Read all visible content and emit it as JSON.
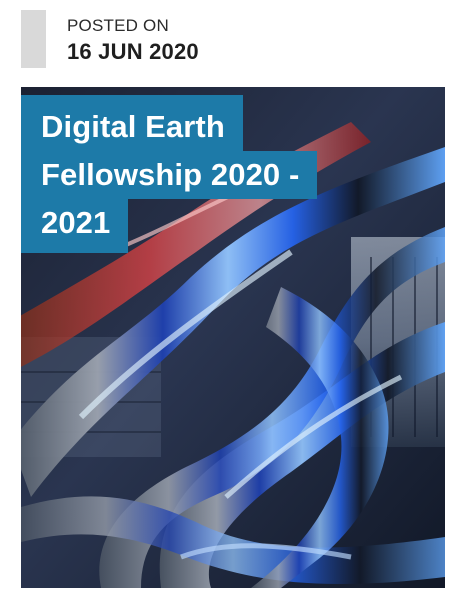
{
  "post_meta": {
    "posted_label": "POSTED ON",
    "date": "16 JUN 2020"
  },
  "featured": {
    "title_lines": [
      "Digital Earth",
      "Fellowship 2020 -",
      "2021"
    ],
    "image": {
      "icon": "abstract-light-art-image",
      "colors": {
        "title_bg": "#1d7aa8",
        "accent_gray": "#d9d9d9"
      }
    }
  }
}
